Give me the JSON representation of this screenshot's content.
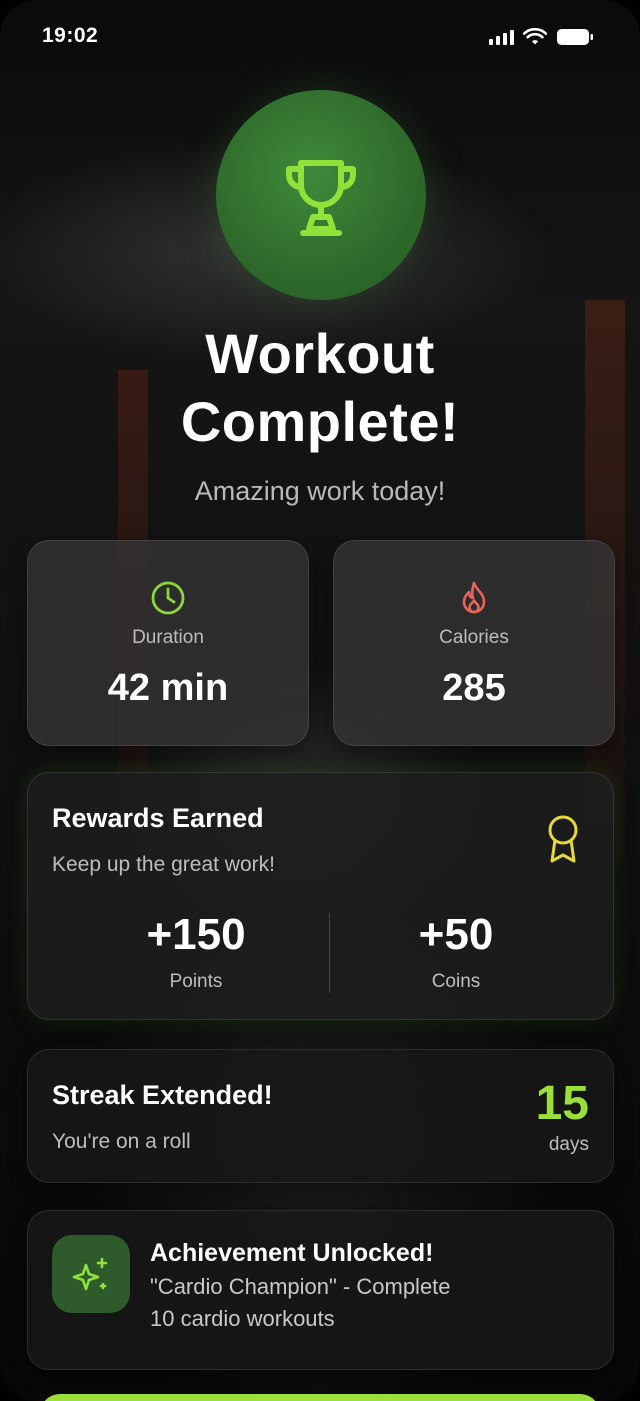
{
  "status_bar": {
    "time": "19:02"
  },
  "hero": {
    "icon": "trophy-icon",
    "title_line1": "Workout",
    "title_line2": "Complete!",
    "subtitle": "Amazing work today!"
  },
  "stats": [
    {
      "icon": "clock-icon",
      "label": "Duration",
      "value": "42 min",
      "icon_color": "#8fd63c"
    },
    {
      "icon": "flame-icon",
      "label": "Calories",
      "value": "285",
      "icon_color": "#e8645a"
    }
  ],
  "rewards": {
    "title": "Rewards Earned",
    "subtitle": "Keep up the great work!",
    "icon": "medal-icon",
    "points_value": "+150",
    "points_label": "Points",
    "coins_value": "+50",
    "coins_label": "Coins"
  },
  "streak": {
    "title": "Streak Extended!",
    "subtitle": "You're on a roll",
    "count": "15",
    "unit": "days"
  },
  "achievement": {
    "icon": "sparkles-icon",
    "title": "Achievement Unlocked!",
    "description_line1": "\"Cardio Champion\" - Complete",
    "description_line2": "10 cardio workouts"
  },
  "colors": {
    "accent": "#9be03a",
    "trophy_bg": "#2e6a2b",
    "card_bg": "#333333"
  }
}
